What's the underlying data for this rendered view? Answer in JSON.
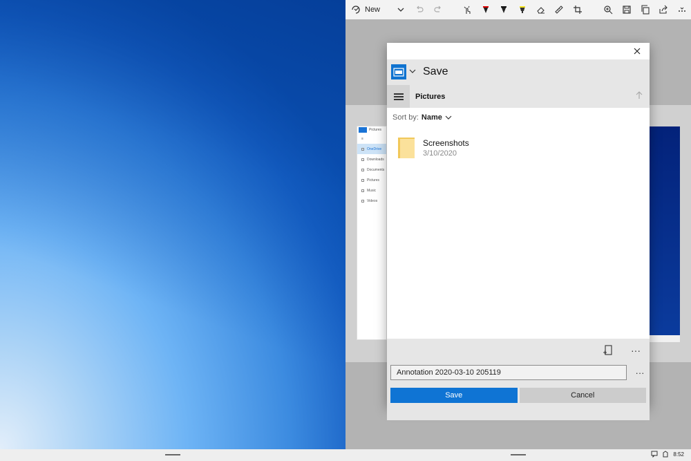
{
  "toolbar": {
    "new_label": "New",
    "icons": [
      "new-snip-icon",
      "chevron-down-icon",
      "undo-icon",
      "redo-icon",
      "touch-writing-icon",
      "ballpoint-pen-icon",
      "pencil-icon",
      "highlighter-icon",
      "eraser-icon",
      "ruler-icon",
      "crop-icon",
      "zoom-icon",
      "save-icon",
      "copy-icon",
      "share-icon",
      "more-icon"
    ]
  },
  "screenshot_preview": {
    "sidebar_title": "Pictures",
    "sidebar_items": [
      "OneDrive",
      "Downloads",
      "Documents",
      "Pictures",
      "Music",
      "Videos"
    ]
  },
  "dialog": {
    "title": "Save",
    "location": "Pictures",
    "sort_prefix": "Sort by:",
    "sort_value": "Name",
    "items": [
      {
        "name": "Screenshots",
        "date": "3/10/2020"
      }
    ],
    "filename": "Annotation 2020-03-10 205119",
    "save_label": "Save",
    "cancel_label": "Cancel",
    "more_glyph": "···"
  },
  "taskbar": {
    "time": "8:52"
  }
}
